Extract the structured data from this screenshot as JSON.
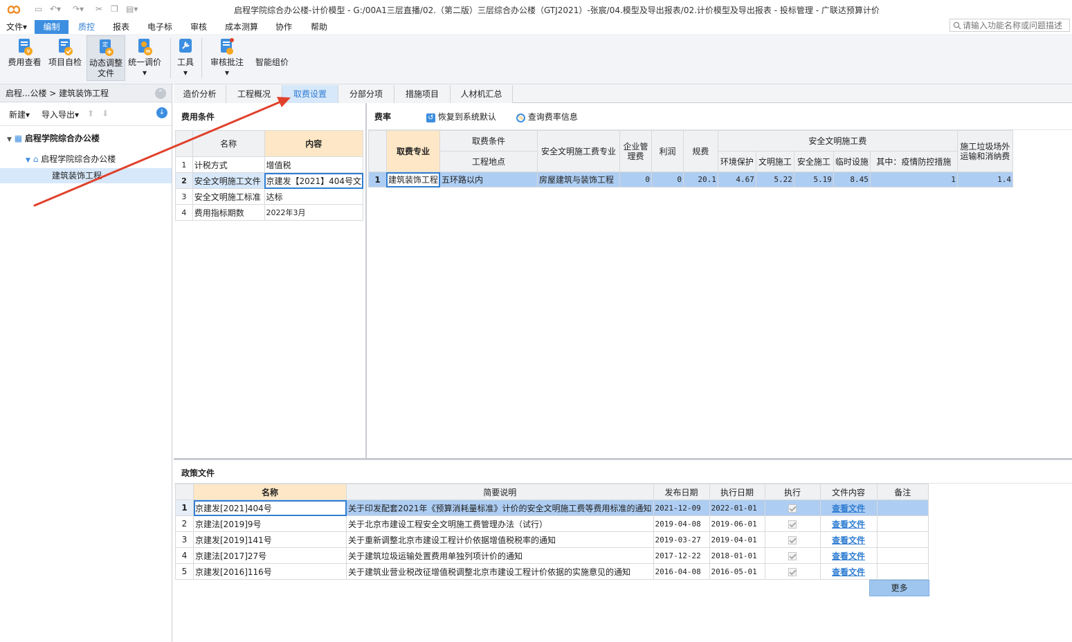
{
  "window": {
    "title": "启程学院综合办公楼-计价模型 - G:/00A1三层直播/02.（第二版）三层综合办公楼（GTJ2021）-张宸/04.模型及导出报表/02.计价模型及导出报表 - 投标管理 - 广联达预算计价"
  },
  "menu": {
    "items": [
      "文件▾",
      "编制",
      "质控",
      "报表",
      "电子标",
      "审核",
      "成本测算",
      "协作",
      "帮助"
    ],
    "active": "编制"
  },
  "search": {
    "placeholder": "请输入功能名称或问题描述"
  },
  "toolbar": {
    "fee_view": "费用查看",
    "self_check": "项目自检",
    "dyn_adjust_1": "动态调整",
    "dyn_adjust_2": "文件",
    "unify_price": "统一调价",
    "tools": "工具",
    "review": "审核批注",
    "smart_price": "智能组价"
  },
  "left": {
    "breadcrumb": "启程...公楼 > 建筑装饰工程",
    "new_label": "新建▾",
    "import_export": "导入导出▾",
    "tree_root": "启程学院综合办公楼",
    "tree_child": "启程学院综合办公楼",
    "tree_leaf": "建筑装饰工程"
  },
  "tabs": [
    "造价分析",
    "工程概况",
    "取费设置",
    "分部分项",
    "措施项目",
    "人材机汇总"
  ],
  "active_tab": "取费设置",
  "fee_conditions": {
    "title": "费用条件",
    "col_name": "名称",
    "col_content": "内容",
    "rows": [
      {
        "no": "1",
        "name": "计税方式",
        "content": "增值税"
      },
      {
        "no": "2",
        "name": "安全文明施工文件",
        "content": "京建发【2021】404号文"
      },
      {
        "no": "3",
        "name": "安全文明施工标准",
        "content": "达标"
      },
      {
        "no": "4",
        "name": "费用指标期数",
        "content": "2022年3月"
      }
    ]
  },
  "rates": {
    "title": "费率",
    "restore": "恢复到系统默认",
    "query": "查询费率信息",
    "h_major": "取费专业",
    "h_condition": "取费条件",
    "h_location": "工程地点",
    "h_safety_major": "安全文明施工费专业",
    "h_mgmt": "企业管理费",
    "h_profit": "利润",
    "h_fees": "规费",
    "h_safety": "安全文明施工费",
    "h_env": "环境保护",
    "h_civil": "文明施工",
    "h_safe": "安全施工",
    "h_temp": "临时设施",
    "h_epidemic": "其中：疫情防控措施",
    "h_waste": "施工垃圾场外运输和消纳费",
    "row": {
      "no": "1",
      "major": "建筑装饰工程",
      "location": "五环路以内",
      "safety_major": "房屋建筑与装饰工程",
      "mgmt": "0",
      "profit": "0",
      "fees": "20.1",
      "env": "4.67",
      "civil": "5.22",
      "safe": "5.19",
      "temp": "8.45",
      "epidemic": "1",
      "waste": "1.4"
    }
  },
  "policy": {
    "title": "政策文件",
    "headers": [
      "名称",
      "简要说明",
      "发布日期",
      "执行日期",
      "执行",
      "文件内容",
      "备注"
    ],
    "rows": [
      {
        "no": "1",
        "name": "京建发[2021]404号",
        "desc": "关于印发配套2021年《预算消耗量标准》计价的安全文明施工费等费用标准的通知",
        "pub": "2021-12-09",
        "exec": "2022-01-01",
        "link": "查看文件",
        "note": ""
      },
      {
        "no": "2",
        "name": "京建法[2019]9号",
        "desc": "关于北京市建设工程安全文明施工费管理办法（试行）",
        "pub": "2019-04-08",
        "exec": "2019-06-01",
        "link": "查看文件",
        "note": ""
      },
      {
        "no": "3",
        "name": "京建发[2019]141号",
        "desc": "关于重新调整北京市建设工程计价依据增值税税率的通知",
        "pub": "2019-03-27",
        "exec": "2019-04-01",
        "link": "查看文件",
        "note": ""
      },
      {
        "no": "4",
        "name": "京建法[2017]27号",
        "desc": "关于建筑垃圾运输处置费用单独列项计价的通知",
        "pub": "2017-12-22",
        "exec": "2018-01-01",
        "link": "查看文件",
        "note": ""
      },
      {
        "no": "5",
        "name": "京建发[2016]116号",
        "desc": "关于建筑业营业税改征增值税调整北京市建设工程计价依据的实施意见的通知",
        "pub": "2016-04-08",
        "exec": "2016-05-01",
        "link": "查看文件",
        "note": ""
      }
    ],
    "more": "更多"
  },
  "colors": {
    "accent": "#3c8ee0",
    "selection": "#aecdf2",
    "arrow": "#e0412c"
  }
}
